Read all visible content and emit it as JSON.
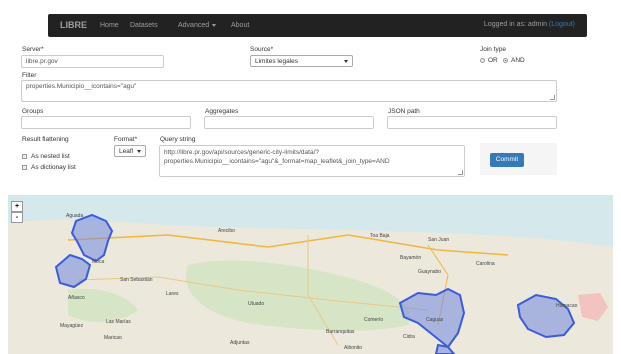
{
  "navbar": {
    "brand": "LIBRE",
    "links": [
      "Home",
      "Datasets",
      "Advanced",
      "About"
    ],
    "logged_prefix": "Logged in as: admin",
    "logout": "(Logout)"
  },
  "form": {
    "server_label": "Server*",
    "server_value": "libre.pr.gov",
    "source_label": "Source*",
    "source_value": "Limites legales",
    "join_label": "Join type",
    "join_options": [
      "OR",
      "AND"
    ],
    "join_selected": "AND",
    "filter_label": "Filter",
    "filter_value": "properties.Municipio__icontains=\"agu\"",
    "groups_label": "Groups",
    "aggregates_label": "Aggregates",
    "json_path_label": "JSON path",
    "flattening_label": "Result flattening",
    "flatten_options": [
      "As nested list",
      "As dictionay list"
    ],
    "format_label": "Format*",
    "format_value": "Leafl",
    "query_label": "Query string",
    "query_value_1": "http://libre.pr.gov/api/sources/generic-city-limits/data/?",
    "query_value_2": "properties.Municipio__icontains=\"agu\"&_format=map_leaflet&_join_type=AND",
    "commit_label": "Commit"
  },
  "map": {
    "zoom_in": "+",
    "zoom_out": "-",
    "labels": [
      "Arecibo",
      "Aguada",
      "Moca",
      "San Sebastián",
      "Lares",
      "Utuado",
      "Añasco",
      "Mayagüez",
      "Adjuntas",
      "Toa Baja",
      "San Juan",
      "Bayamón",
      "Carolina",
      "Guaynabo",
      "Caguas",
      "Cidra",
      "Comerío",
      "Barranquitas",
      "Aibonito",
      "Humacao",
      "Las Marías",
      "Maricao"
    ],
    "polygon_fill": "#7b8fe0",
    "polygon_stroke": "#3b5bdb"
  }
}
